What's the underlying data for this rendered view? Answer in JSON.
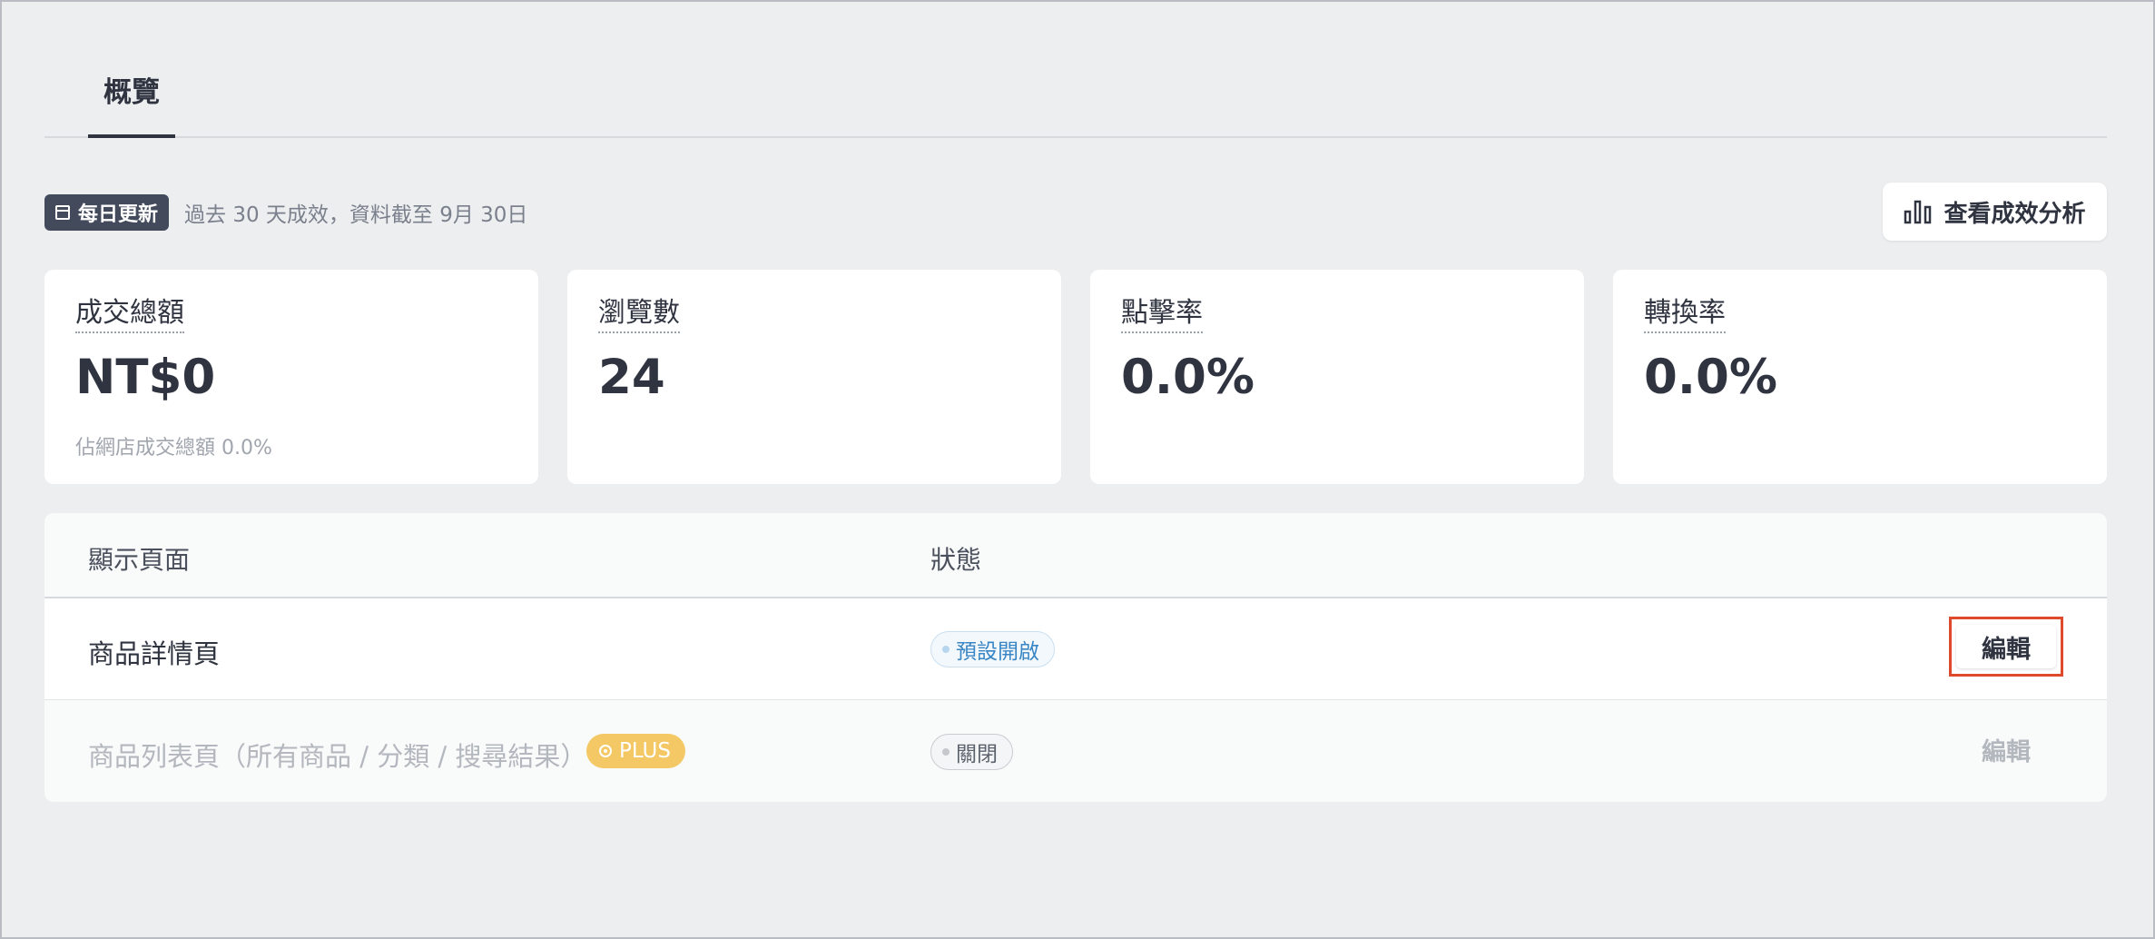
{
  "tabs": [
    {
      "label": "概覽"
    }
  ],
  "info": {
    "badge_label": "每日更新",
    "period_text": "過去 30 天成效，資料截至 9月 30日"
  },
  "analysis_button": {
    "label": "查看成效分析",
    "icon": "bar-chart-icon"
  },
  "metrics": [
    {
      "label": "成交總額",
      "value": "NT$0",
      "sub": "佔網店成交總額 0.0%"
    },
    {
      "label": "瀏覽數",
      "value": "24"
    },
    {
      "label": "點擊率",
      "value": "0.0%"
    },
    {
      "label": "轉換率",
      "value": "0.0%"
    }
  ],
  "table": {
    "headers": {
      "page": "顯示頁面",
      "status": "狀態"
    },
    "rows": [
      {
        "page": "商品詳情頁",
        "status": "預設開啟",
        "action": "編輯"
      },
      {
        "page": "商品列表頁（所有商品 / 分類 / 搜尋結果）",
        "badge": "PLUS",
        "status": "關閉",
        "action": "編輯"
      }
    ]
  },
  "colors": {
    "accent_dark": "#424a5b",
    "highlight_border": "#e04a2c",
    "plus_badge": "#f4c865",
    "status_on": "#3a86c4"
  }
}
